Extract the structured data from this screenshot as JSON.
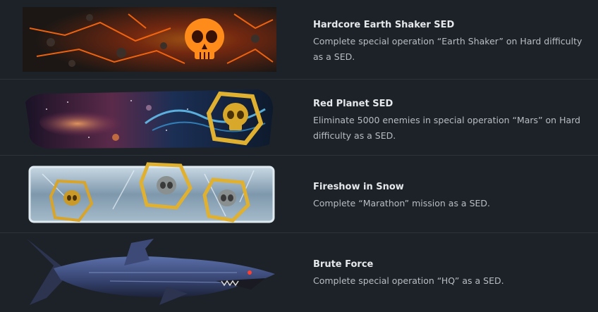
{
  "achievements": [
    {
      "title": "Hardcore Earth Shaker SED",
      "description": "Complete special operation “Earth Shaker” on Hard difficulty as a SED.",
      "art_icon": "molten-skull-banner-icon"
    },
    {
      "title": "Red Planet SED",
      "description": "Eliminate 5000 enemies in special operation “Mars” on Hard difficulty as a SED.",
      "art_icon": "space-skull-banner-icon"
    },
    {
      "title": "Fireshow in Snow",
      "description": "Complete “Marathon” mission as a SED.",
      "art_icon": "ice-skulls-banner-icon"
    },
    {
      "title": "Brute Force",
      "description": "Complete special operation “HQ” as a SED.",
      "art_icon": "robot-shark-banner-icon"
    }
  ],
  "colors": {
    "background": "#1d2228",
    "divider": "#2c333b",
    "title": "#e6e9ec",
    "description": "#b7bdc3",
    "gold": "#d4a21e"
  }
}
